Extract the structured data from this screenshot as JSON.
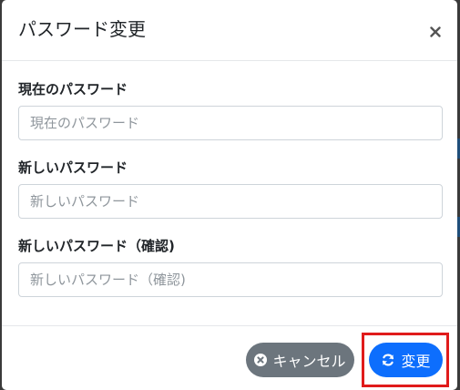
{
  "modal": {
    "title": "パスワード変更",
    "close_icon": "close-icon"
  },
  "form": {
    "current_password": {
      "label": "現在のパスワード",
      "placeholder": "現在のパスワード",
      "value": ""
    },
    "new_password": {
      "label": "新しいパスワード",
      "placeholder": "新しいパスワード",
      "value": ""
    },
    "confirm_password": {
      "label": "新しいパスワード（確認)",
      "placeholder": "新しいパスワード（確認)",
      "value": ""
    }
  },
  "footer": {
    "cancel_label": "キャンセル",
    "cancel_icon": "times-icon",
    "submit_label": "変更",
    "submit_icon": "sync-icon"
  },
  "colors": {
    "primary": "#0d6efd",
    "secondary": "#6c757d",
    "highlight": "#e01b1b"
  }
}
